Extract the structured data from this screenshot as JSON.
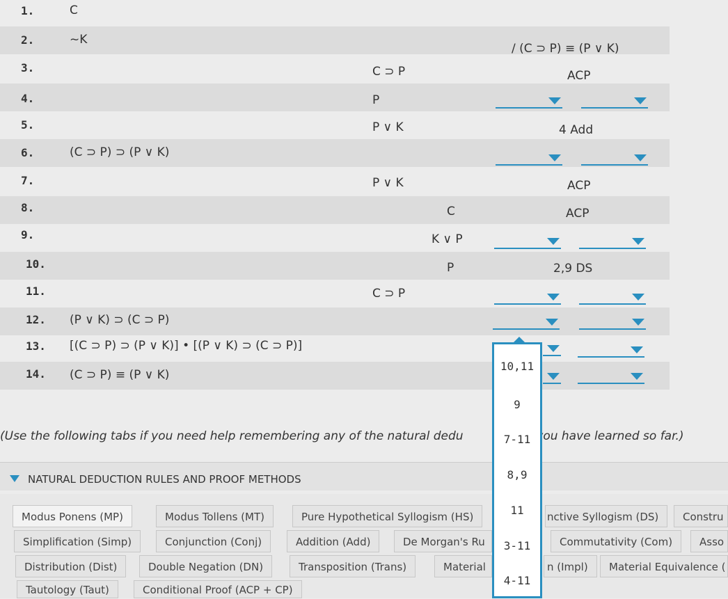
{
  "proof": {
    "goal": "/ (C ⊃ P) ≡ (P ∨ K)",
    "lines": [
      {
        "num": "1.",
        "col1": "C"
      },
      {
        "num": "2.",
        "col1": "~K"
      },
      {
        "num": "3.",
        "col2": "C ⊃ P",
        "just": "ACP"
      },
      {
        "num": "4.",
        "col2": "P"
      },
      {
        "num": "5.",
        "col2": "P ∨ K",
        "just": "4 Add"
      },
      {
        "num": "6.",
        "col1": "(C ⊃ P) ⊃ (P ∨ K)"
      },
      {
        "num": "7.",
        "col2": "P ∨ K",
        "just": "ACP"
      },
      {
        "num": "8.",
        "col3": "C",
        "just": "ACP"
      },
      {
        "num": "9.",
        "col3": "K ∨ P"
      },
      {
        "num": "10.",
        "col3": "P",
        "just": "2,9 DS"
      },
      {
        "num": "11.",
        "col2": "C ⊃ P"
      },
      {
        "num": "12.",
        "col1": "(P ∨ K) ⊃ (C ⊃ P)"
      },
      {
        "num": "13.",
        "col1": "[(C ⊃ P) ⊃ (P ∨ K)] • [(P ∨ K) ⊃ (C ⊃ P)]"
      },
      {
        "num": "14.",
        "col1": "(C ⊃ P) ≡ (P ∨ K)"
      }
    ]
  },
  "line_dropdown": {
    "options": [
      "10,11",
      "9",
      "7-11",
      "8,9",
      "11",
      "3-11",
      "4-11"
    ]
  },
  "help_note": "(Use the following tabs if you need help remembering any of the natural dedu",
  "help_note_tail": "es you have learned so far.)",
  "rules_section": {
    "title": "NATURAL DEDUCTION RULES AND PROOF METHODS",
    "tabs_row1": [
      "Modus Ponens (MP)",
      "Modus Tollens (MT)",
      "Pure Hypothetical Syllogism (HS)",
      "nctive Syllogism (DS)",
      "Constru"
    ],
    "tabs_row2": [
      "Simplification (Simp)",
      "Conjunction (Conj)",
      "Addition (Add)",
      "De Morgan's Ru",
      "Commutativity (Com)",
      "Asso"
    ],
    "tabs_row3": [
      "Distribution (Dist)",
      "Double Negation (DN)",
      "Transposition (Trans)",
      "Material",
      "n (Impl)",
      "Material Equivalence ("
    ],
    "tabs_row4": [
      "Tautology (Taut)",
      "Conditional Proof (ACP + CP)"
    ]
  },
  "colors": {
    "accent": "#2a8fc0",
    "row_shade": "#dcdcdc",
    "background": "#ececec"
  }
}
